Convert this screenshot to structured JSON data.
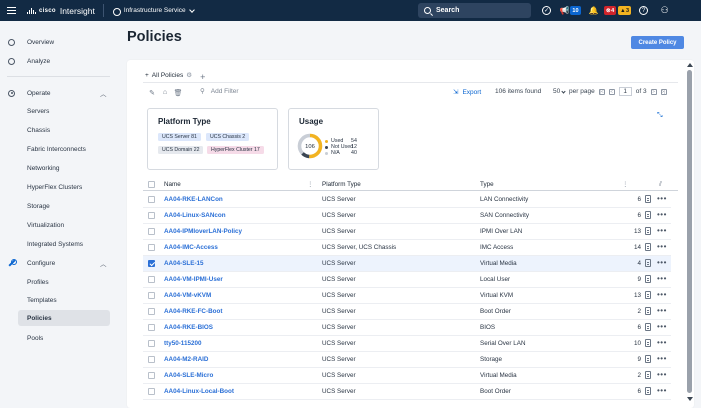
{
  "topbar": {
    "brand": "cisco",
    "app_name": "Intersight",
    "service": "Infrastructure Service",
    "search_label": "Search",
    "notifications_count": "10",
    "alarm_critical_count": "4",
    "alarm_warning_count": "3"
  },
  "sidebar": {
    "overview": "Overview",
    "analyze": "Analyze",
    "operate": "Operate",
    "operate_items": [
      "Servers",
      "Chassis",
      "Fabric Interconnects",
      "Networking",
      "HyperFlex Clusters",
      "Storage",
      "Virtualization",
      "Integrated Systems"
    ],
    "configure": "Configure",
    "configure_items": [
      "Profiles",
      "Templates",
      "Policies",
      "Pools"
    ]
  },
  "page": {
    "title": "Policies",
    "create_button": "Create Policy"
  },
  "tabs": {
    "all_policies": "All Policies",
    "add": "+"
  },
  "toolbar": {
    "filter_placeholder": "Add Filter",
    "export": "Export",
    "items_found": "106 items found",
    "per_page_value": "50",
    "per_page_label": "per page",
    "page_current": "1",
    "page_total": "of 3"
  },
  "widgets": {
    "platform_type": {
      "title": "Platform Type",
      "chips": [
        "UCS Server 81",
        "UCS Chassis 2",
        "UCS Domain 22",
        "HyperFlex Cluster 17"
      ]
    },
    "usage": {
      "title": "Usage",
      "total": "106",
      "legend": [
        {
          "label": "Used",
          "count": "54",
          "color": "#f2b321"
        },
        {
          "label": "Not Used",
          "count": "12",
          "color": "#3b4653"
        },
        {
          "label": "N/A",
          "count": "40",
          "color": "#c9ced6"
        }
      ]
    }
  },
  "table": {
    "headers": {
      "name": "Name",
      "platform_type": "Platform Type",
      "type": "Type"
    },
    "rows": [
      {
        "name": "AA04-RKE-LANCon",
        "platform": "UCS Server",
        "type": "LAN Connectivity",
        "usage": "6",
        "checked": false
      },
      {
        "name": "AA04-Linux-SANcon",
        "platform": "UCS Server",
        "type": "SAN Connectivity",
        "usage": "6",
        "checked": false
      },
      {
        "name": "AA04-IPMIoverLAN-Policy",
        "platform": "UCS Server",
        "type": "IPMI Over LAN",
        "usage": "13",
        "checked": false
      },
      {
        "name": "AA04-IMC-Access",
        "platform": "UCS Server, UCS Chassis",
        "type": "IMC Access",
        "usage": "14",
        "checked": false
      },
      {
        "name": "AA04-SLE-15",
        "platform": "UCS Server",
        "type": "Virtual Media",
        "usage": "4",
        "checked": true
      },
      {
        "name": "AA04-VM-IPMI-User",
        "platform": "UCS Server",
        "type": "Local User",
        "usage": "9",
        "checked": false
      },
      {
        "name": "AA04-VM-vKVM",
        "platform": "UCS Server",
        "type": "Virtual KVM",
        "usage": "13",
        "checked": false
      },
      {
        "name": "AA04-RKE-FC-Boot",
        "platform": "UCS Server",
        "type": "Boot Order",
        "usage": "2",
        "checked": false
      },
      {
        "name": "AA04-RKE-BIOS",
        "platform": "UCS Server",
        "type": "BIOS",
        "usage": "6",
        "checked": false
      },
      {
        "name": "tty50-115200",
        "platform": "UCS Server",
        "type": "Serial Over LAN",
        "usage": "10",
        "checked": false
      },
      {
        "name": "AA04-M2-RAID",
        "platform": "UCS Server",
        "type": "Storage",
        "usage": "9",
        "checked": false
      },
      {
        "name": "AA04-SLE-Micro",
        "platform": "UCS Server",
        "type": "Virtual Media",
        "usage": "2",
        "checked": false
      },
      {
        "name": "AA04-Linux-Local-Boot",
        "platform": "UCS Server",
        "type": "Boot Order",
        "usage": "6",
        "checked": false
      }
    ]
  }
}
